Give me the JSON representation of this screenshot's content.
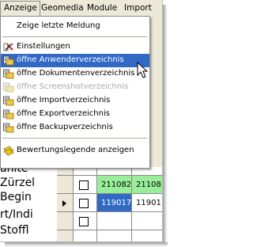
{
  "menubar": {
    "items": [
      "Anzeige",
      "Geomedia",
      "Module",
      "Import"
    ]
  },
  "dropdown": {
    "items": [
      {
        "label": "Zeige letzte Meldung",
        "icon": "none",
        "state": "normal"
      },
      {
        "label": "Einstellungen",
        "icon": "settings-icon",
        "state": "normal"
      },
      {
        "label": "öffne Anwenderverzeichnis",
        "icon": "folder-icon",
        "state": "highlighted"
      },
      {
        "label": "öffne Dokumentenverzeichnis",
        "icon": "folder-icon",
        "state": "normal"
      },
      {
        "label": "öffne Screenshotverzeichnis",
        "icon": "folder-icon",
        "state": "disabled"
      },
      {
        "label": "öffne Importverzeichnis",
        "icon": "folder-icon",
        "state": "normal"
      },
      {
        "label": "öffne Exportverzeichnis",
        "icon": "folder-icon",
        "state": "normal"
      },
      {
        "label": "öffne Backupverzeichnis",
        "icon": "folder-icon",
        "state": "normal"
      },
      {
        "label": "Bewertungslegende anzeigen",
        "icon": "legend-icon",
        "state": "normal"
      }
    ]
  },
  "background": {
    "left_texts": [
      "anite",
      "Zürzel",
      "Begin",
      "rt/Indi",
      "Stoffl"
    ],
    "rows": [
      {
        "cells": [
          "211082",
          "21108"
        ]
      },
      {
        "cells": [
          "119017",
          "11901"
        ]
      },
      {
        "cells": [
          "",
          ""
        ]
      }
    ]
  },
  "colors": {
    "menubar_bg": "#ece9d8",
    "highlight": "#316ac5",
    "row_green": "#99ee99",
    "row_selected": "#316ac5",
    "disabled_text": "#a8a8a8"
  }
}
